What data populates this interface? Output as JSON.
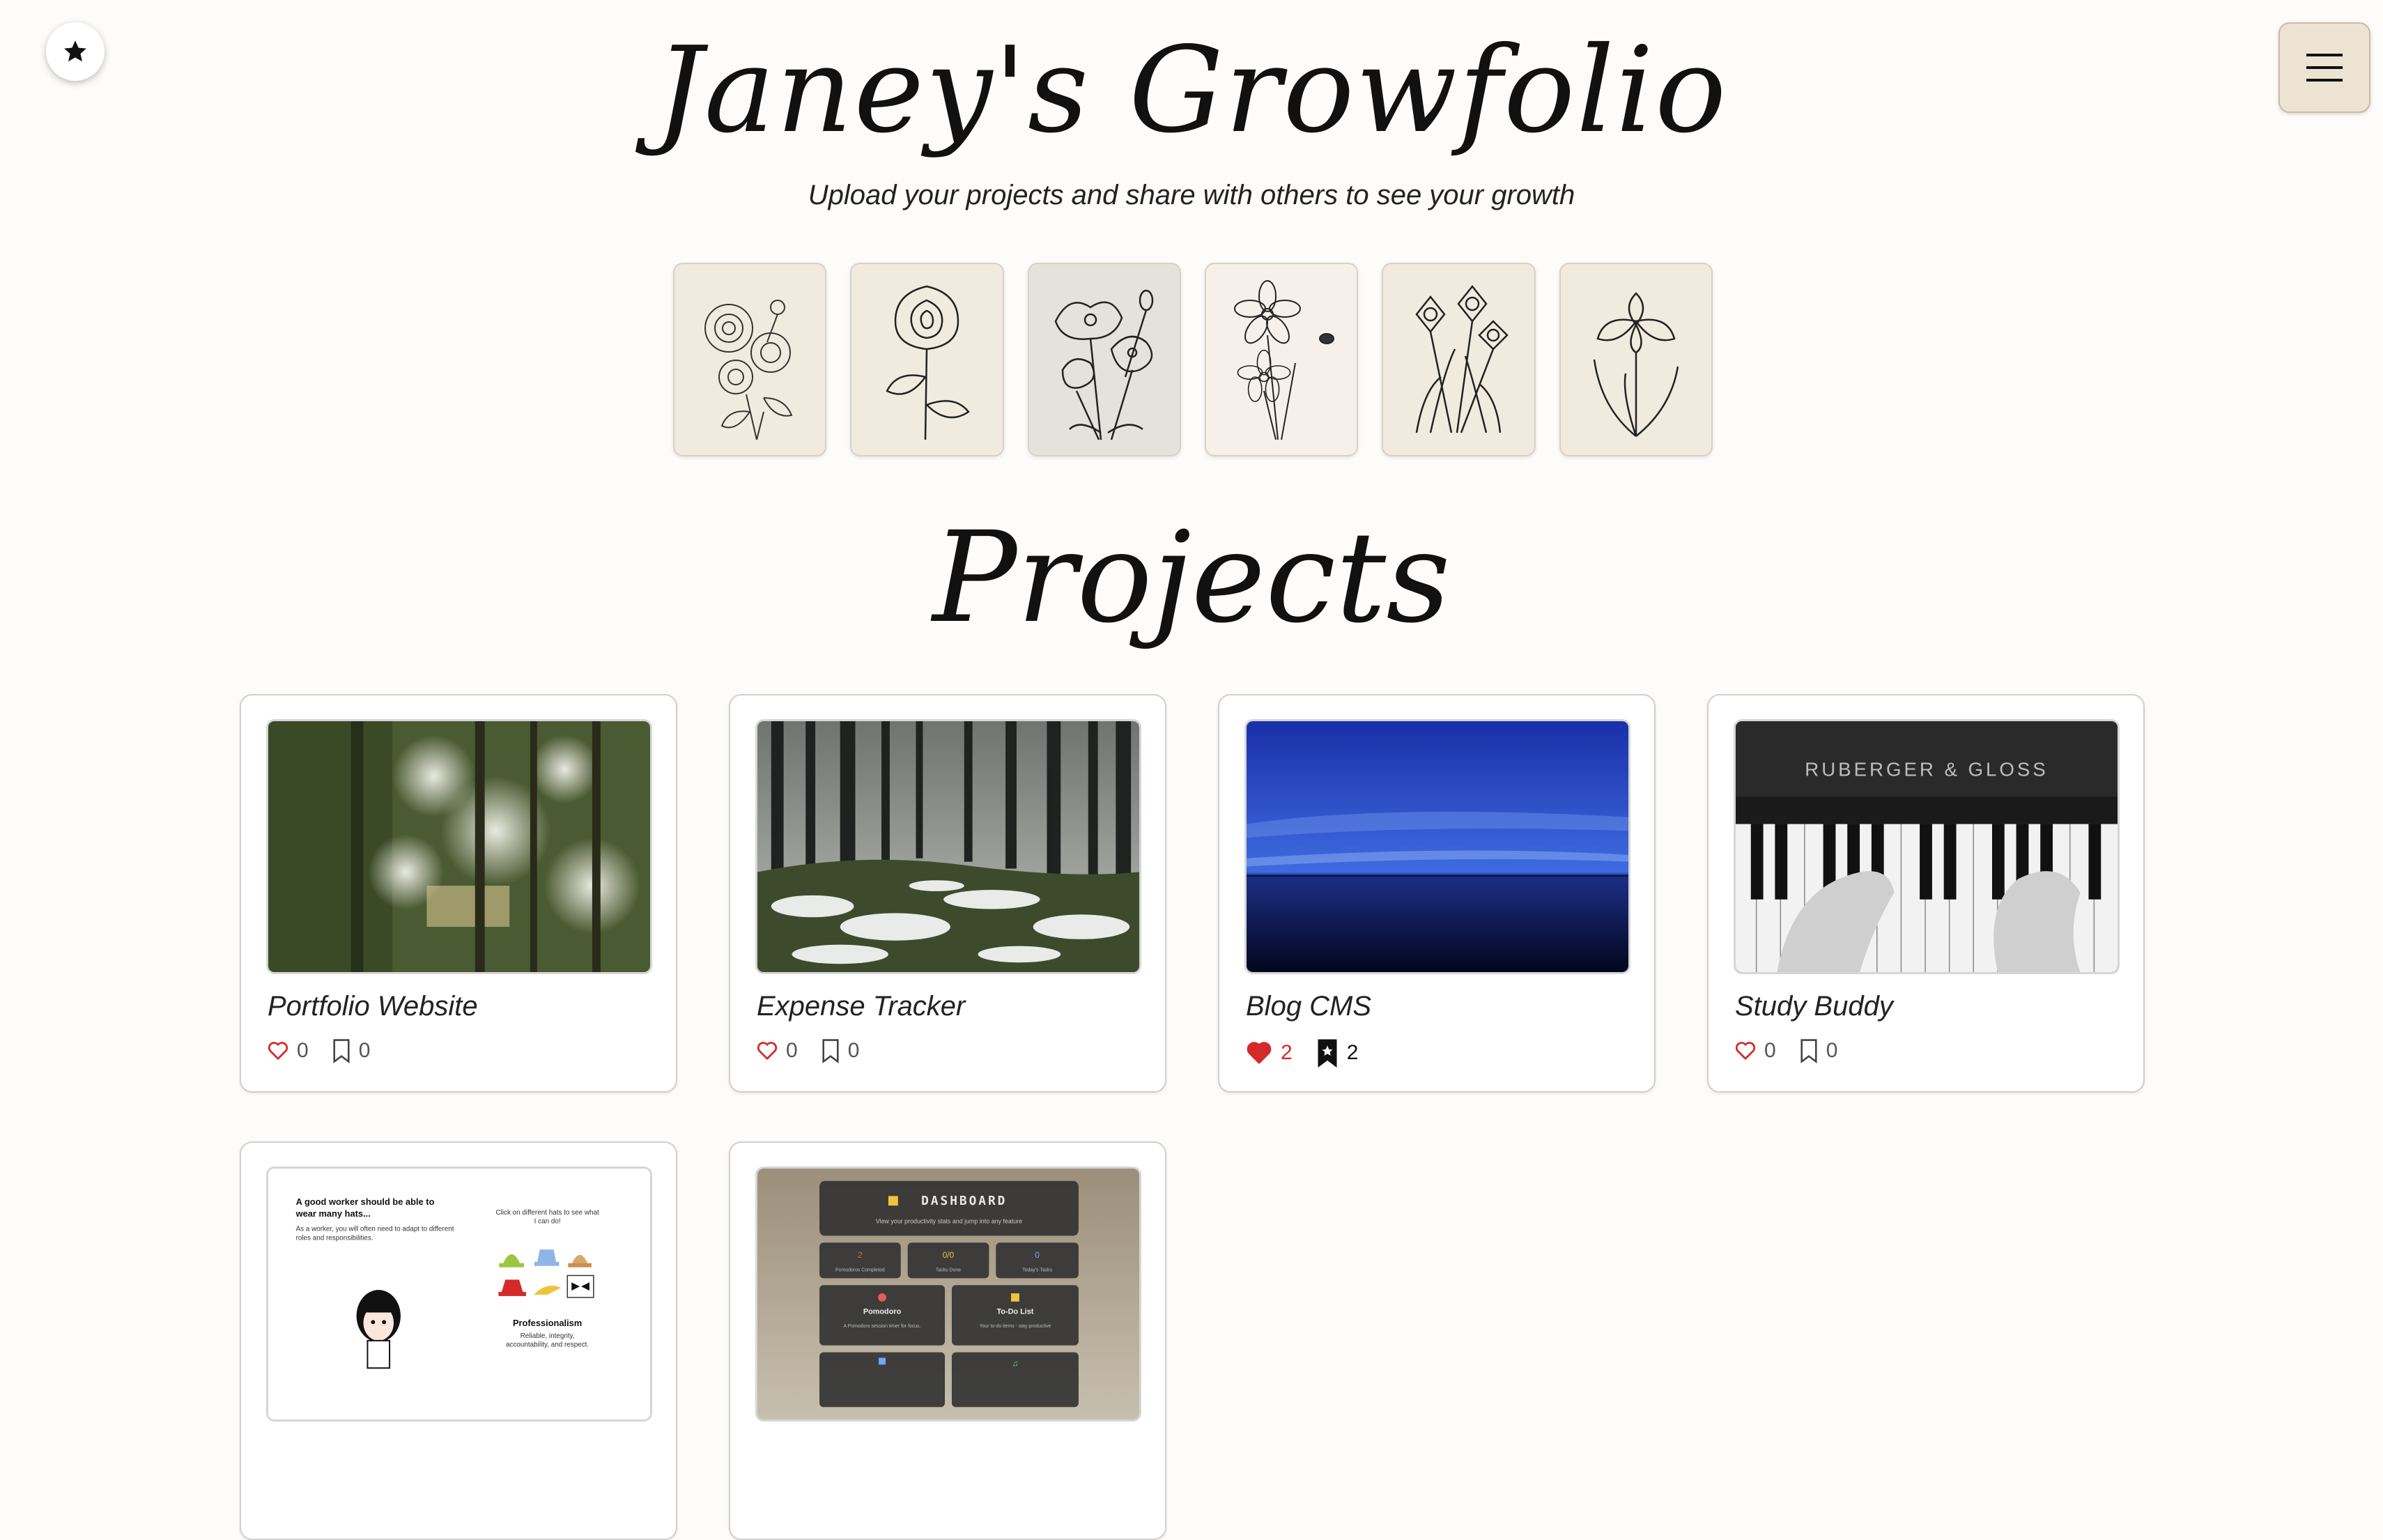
{
  "header": {
    "title": "Janey's Growfolio",
    "subtitle": "Upload your projects and share with others to see your growth"
  },
  "flowers": [
    {
      "icon": "peony-sketch"
    },
    {
      "icon": "rose-sketch"
    },
    {
      "icon": "poppy-sketch"
    },
    {
      "icon": "cosmos-sketch"
    },
    {
      "icon": "daffodil-sketch"
    },
    {
      "icon": "iris-sketch"
    }
  ],
  "section": {
    "title": "Projects"
  },
  "projects": [
    {
      "title": "Portfolio Website",
      "likes": "0",
      "saves": "0",
      "liked": false,
      "saved": false,
      "image": "forest-bokeh"
    },
    {
      "title": "Expense Tracker",
      "likes": "0",
      "saves": "0",
      "liked": false,
      "saved": false,
      "image": "snowy-forest"
    },
    {
      "title": "Blog CMS",
      "likes": "2",
      "saves": "2",
      "liked": true,
      "saved": true,
      "image": "blue-lake"
    },
    {
      "title": "Study Buddy",
      "likes": "0",
      "saves": "0",
      "liked": false,
      "saved": false,
      "image": "piano-hands"
    },
    {
      "title": "",
      "likes": "",
      "saves": "",
      "image": "hats-app"
    },
    {
      "title": "",
      "likes": "",
      "saves": "",
      "image": "dashboard-app"
    }
  ],
  "thumb_text": {
    "piano_brand": "RUBERGER & GLOSS",
    "hats_heading": "A good worker should be able to wear many hats...",
    "hats_body": "As a worker, you will often need to adapt to different roles and responsibilities.",
    "hats_prompt": "Click on different hats to see what I can do!",
    "hats_label": "Professionalism",
    "hats_desc": "Reliable, integrity, accountability, and respect.",
    "dash_title": "DASHBOARD",
    "dash_sub": "View your productivity stats and jump into any feature",
    "dash_stat1": "2",
    "dash_stat1_label": "Pomodoros Completed",
    "dash_stat2": "0/0",
    "dash_stat2_label": "Tasks Done",
    "dash_stat3": "0",
    "dash_stat3_label": "Today's Tasks",
    "dash_tile1": "Pomodoro",
    "dash_tile1_sub": "A Pomodoro session timer for focus.",
    "dash_tile2": "To-Do List",
    "dash_tile2_sub": "Your to-do items - stay productive"
  },
  "colors": {
    "background": "#fdfcfb",
    "menu_button": "#ede3d2",
    "like_active": "#d42a2a"
  }
}
